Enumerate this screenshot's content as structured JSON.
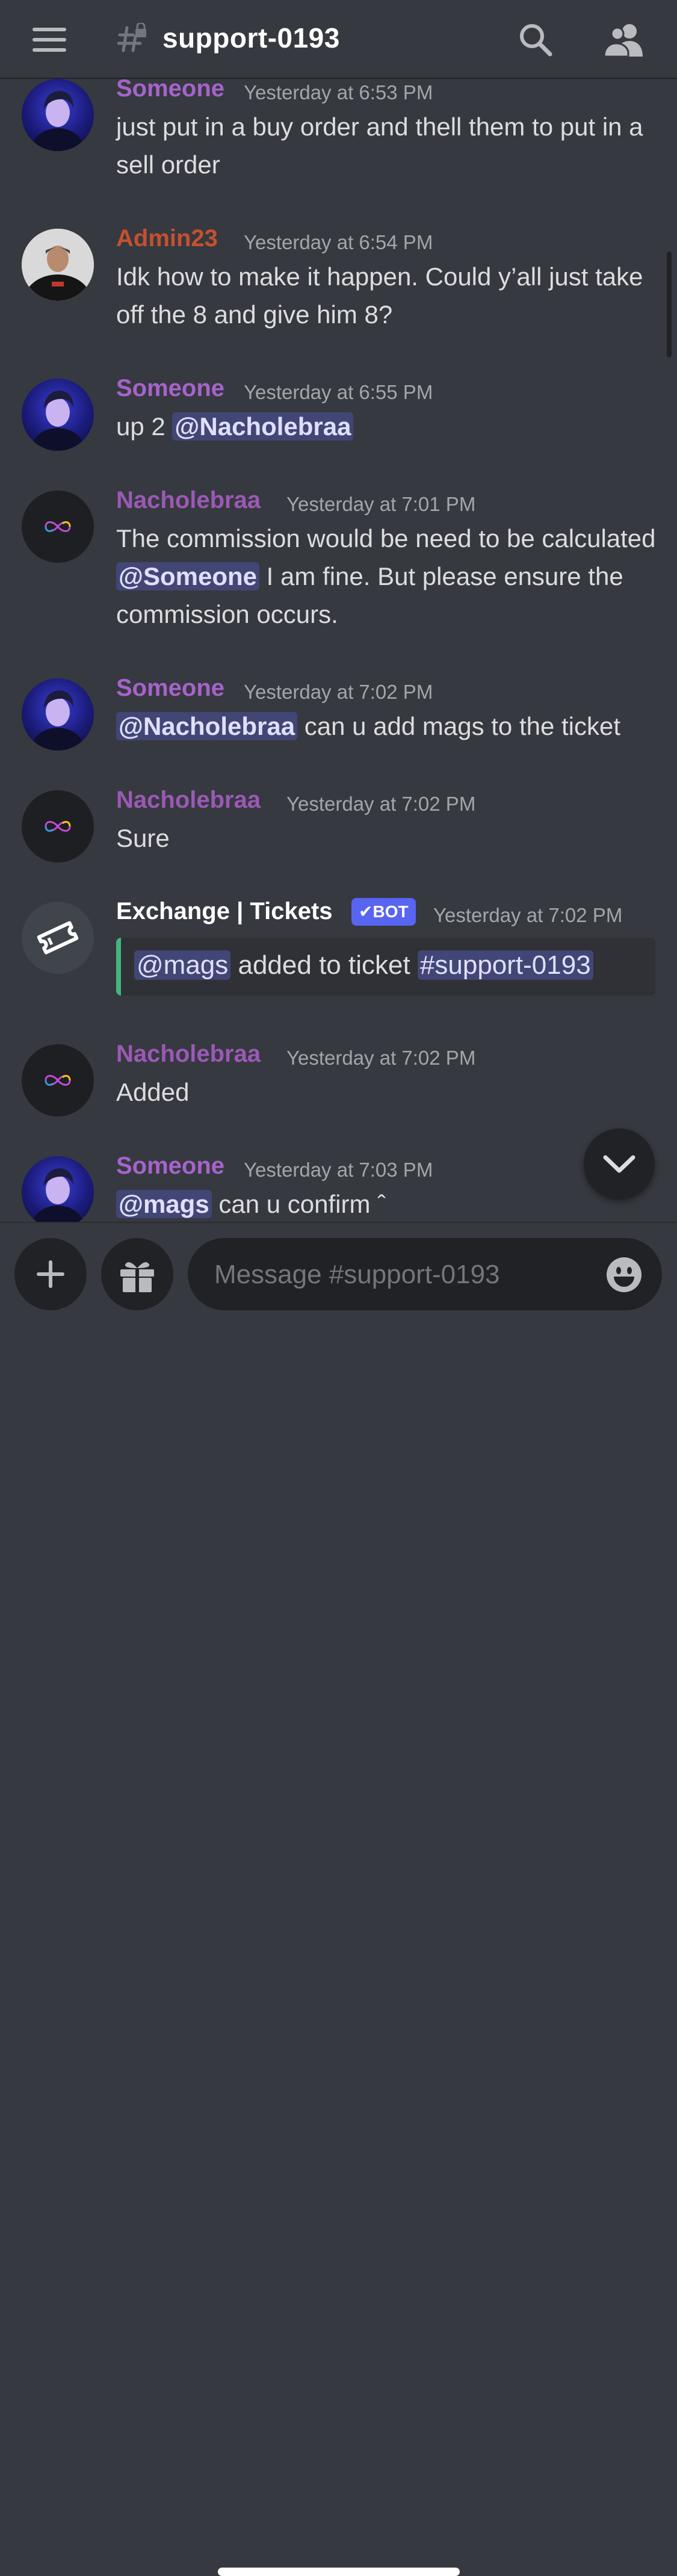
{
  "header": {
    "channel_name": "support-0193",
    "menu_icon": "hamburger-icon",
    "channel_icon": "locked-hash-icon",
    "search_icon": "search-icon",
    "members_icon": "members-icon"
  },
  "messages": [
    {
      "author": "Someone",
      "timestamp": "Yesterday at 6:53 PM",
      "text": "just put in a buy order and thell them to put in a sell order"
    },
    {
      "author": "Admin23",
      "timestamp": "Yesterday at 6:54 PM",
      "text": "Idk how to make it happen. Could y’all just take off the 8 and give him 8?"
    },
    {
      "author": "Someone",
      "timestamp": "Yesterday at 6:55 PM",
      "text_before": "up 2 ",
      "mention": "@Nacholebraa"
    },
    {
      "author": "Nacholebraa",
      "timestamp": "Yesterday at 7:01 PM",
      "text_part1": "The commission would be need to be calculated ",
      "mention": "@Someone",
      "text_part2": "  I am fine. But please ensure the commission occurs."
    },
    {
      "author": "Someone",
      "timestamp": "Yesterday at 7:02 PM",
      "mention": "@Nacholebraa",
      "text_after": " can u add mags to the ticket"
    },
    {
      "author": "Nacholebraa",
      "timestamp": "Yesterday at 7:02 PM",
      "text": "Sure"
    },
    {
      "author": "Exchange | Tickets",
      "badge": "BOT",
      "timestamp": "Yesterday at 7:02 PM",
      "embed": {
        "mention": "@mags",
        "text": " added to ticket ",
        "channel": "#support-0193"
      }
    },
    {
      "author": "Nacholebraa",
      "timestamp": "Yesterday at 7:02 PM",
      "text": "Added"
    },
    {
      "author": "Someone",
      "timestamp": "Yesterday at 7:03 PM",
      "mention": "@mags",
      "text_after": " can u confirm ˆ"
    }
  ],
  "composer": {
    "placeholder": "Message #support-0193",
    "plus_icon": "plus-icon",
    "gift_icon": "gift-icon",
    "emoji_icon": "emoji-icon"
  },
  "jump_icon": "chevron-down-icon",
  "colors": {
    "background": "#36393f",
    "someone_name": "#a663cc",
    "nacholebraa_name": "#9b59b6",
    "admin_name": "#c4512f",
    "mention_bg": "#414675",
    "bot_badge": "#5865f2",
    "embed_border": "#43b581"
  }
}
